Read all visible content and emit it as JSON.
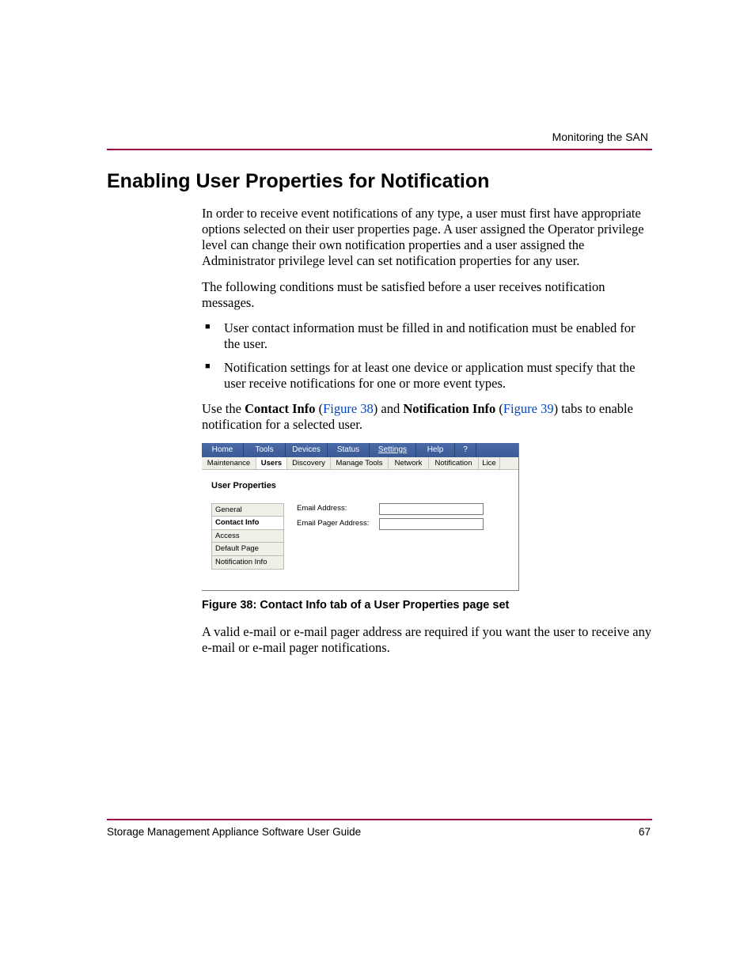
{
  "header": {
    "running_head": "Monitoring the SAN"
  },
  "title": "Enabling User Properties for Notification",
  "para1": "In order to receive event notifications of any type, a user must first have appropriate options selected on their user properties page. A user assigned the Operator privilege level can change their own notification properties and a user assigned the Administrator privilege level can set notification properties for any user.",
  "para2": "The following conditions must be satisfied before a user receives notification messages.",
  "bullets": [
    "User contact information must be filled in and notification must be enabled for the user.",
    "Notification settings for at least one device or application must specify that the user receive notifications for one or more event types."
  ],
  "para3": {
    "pre": "Use the ",
    "b1": "Contact Info",
    "ref1_open": " (",
    "ref1": "Figure 38",
    "ref1_close": ") and ",
    "b2": "Notification Info",
    "ref2_open": " (",
    "ref2": "Figure 39",
    "ref2_close": ") tabs to enable notification for a selected user."
  },
  "figure": {
    "caption": "Figure 38:  Contact Info tab of a User Properties page set",
    "topnav": [
      "Home",
      "Tools",
      "Devices",
      "Status",
      "Settings",
      "Help",
      "?"
    ],
    "topnav_widths": [
      52,
      52,
      52,
      52,
      58,
      48,
      26
    ],
    "topnav_selected": 4,
    "subnav": [
      "Maintenance",
      "Users",
      "Discovery",
      "Manage Tools",
      "Network",
      "Notification",
      "Lice"
    ],
    "subnav_widths": [
      68,
      38,
      54,
      72,
      50,
      62,
      26
    ],
    "subnav_selected": 1,
    "panel_title": "User Properties",
    "sidetabs": [
      "General",
      "Contact Info",
      "Access",
      "Default Page",
      "Notification Info"
    ],
    "sidetabs_selected": 1,
    "fields": [
      {
        "label": "Email Address:"
      },
      {
        "label": "Email Pager Address:"
      }
    ]
  },
  "para4": "A valid e-mail or e-mail pager address are required if you want the user to receive any e-mail or e-mail pager notifications.",
  "footer": {
    "guide": "Storage Management Appliance Software User Guide",
    "page": "67"
  }
}
